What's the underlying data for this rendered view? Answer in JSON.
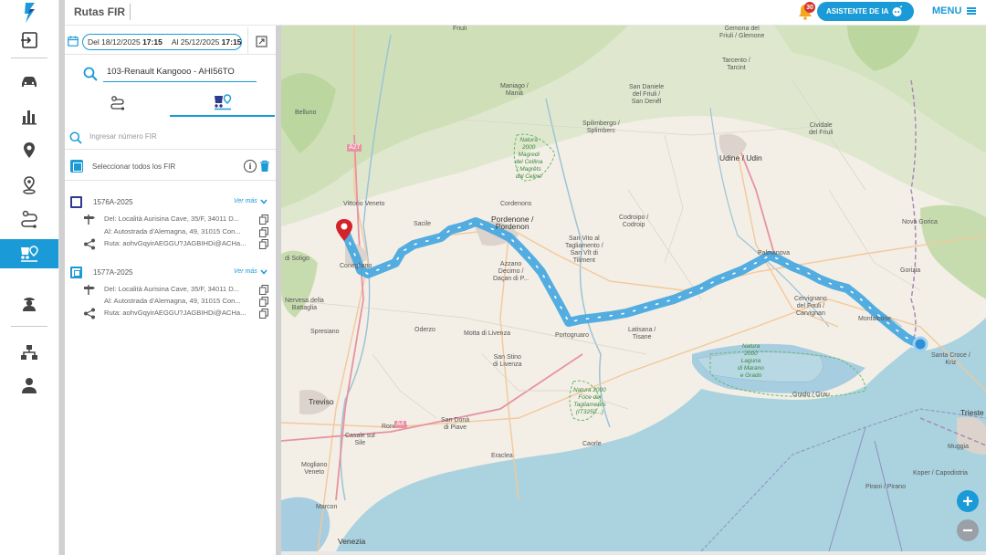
{
  "header": {
    "title": "Rutas FIR",
    "notification_count": "30",
    "ai_button_label": "ASISTENTE DE IA",
    "menu_label": "MENU"
  },
  "colors": {
    "accent": "#1a9ad6",
    "route": "#4aa9df",
    "start_marker": "#d2232a",
    "end_marker": "#2f8fd8"
  },
  "sidebar": {
    "items": [
      {
        "name": "logout-icon"
      },
      {
        "name": "car-icon"
      },
      {
        "name": "bar-chart-icon"
      },
      {
        "name": "location-pin-icon"
      },
      {
        "name": "pin-stand-icon"
      },
      {
        "name": "route-icon"
      },
      {
        "name": "fir-route-icon",
        "active": true
      },
      {
        "name": "driver-icon"
      },
      {
        "name": "hierarchy-icon"
      },
      {
        "name": "user-icon"
      }
    ]
  },
  "filters": {
    "date_from_label": "Del",
    "date_from": "18/12/2025",
    "time_from": "17:15",
    "date_to_label": "Al",
    "date_to": "25/12/2025",
    "time_to": "17:15"
  },
  "vehicle": {
    "value": "103-Renault Kangooo - AHI56TO"
  },
  "fir_panel": {
    "search_placeholder": "Ingresar número FIR",
    "select_all_label": "Seleccionar todos los FIR",
    "see_more": "Ver más",
    "items": [
      {
        "id": "1576A-2025",
        "from": "Del: Località Aurisina Cave, 35/F, 34011 D...",
        "to": "Al: Autostrada d'Alemagna, 49, 31015 Con...",
        "route": "Ruta: aohvGqyirAEGGU?JAGBIHDi@ACHa..."
      },
      {
        "id": "1577A-2025",
        "from": "Del: Località Aurisina Cave, 35/F, 34011 D...",
        "to": "Al: Autostrada d'Alemagna, 49, 31015 Con...",
        "route": "Ruta: aohvGqyirAEGGU?JAGBIHDi@ACHa..."
      }
    ]
  },
  "map": {
    "labels": {
      "friuli": "Friuli",
      "belluno": "Belluno",
      "maniago": "Maniago /\nManià",
      "san_daniele": "San Daniele\ndel Friuli /\nSan Denêl",
      "spilimbergo": "Spilimbergo /\nSplimberc",
      "tarcento": "Tarcento /\nTarcint",
      "gemona": "Gemona del\nFriuli / Glemone",
      "udine": "Udine / Udin",
      "cividale": "Cividale\ndel Friuli",
      "natura_magredi": "Natura\n2000\nMagredi\ndel Cellina\n/ Magrêts\ndal Celine",
      "cordenons": "Cordenons",
      "pordenone": "Pordenone /\nPordenon",
      "sacile": "Sacile",
      "vittorio_veneto": "Vittorio Veneto",
      "conegliano": "Conegliano",
      "soligo": "di Soligo",
      "codroipo": "Codroipo /\nCodroip",
      "san_vito": "San Vito al\nTagliamento /\nSan Vît di\nTiliment",
      "azzano": "Azzano\nDecimo /\nDaçan di P...",
      "nova_gorica": "Nova Gorica",
      "gorizia": "Gorizia",
      "palmanova": "Palmanova",
      "cervignano": "Cervignano\ndel Friuli /\nCarvignan",
      "nervesa": "Nervesa della\nBattaglia",
      "spresiano": "Spresiano",
      "oderzo": "Oderzo",
      "motta": "Motta di Livenza",
      "portogruaro": "Portogruaro",
      "latisana": "Latisana /\nTisane",
      "san_stino": "San Stino\ndi Livenza",
      "natura_laguna": "Natura\n2000\nLaguna\ndi Marano\ne Grado",
      "grado": "Grado / Grau",
      "treviso": "Treviso",
      "san_dona": "San Donà\ndi Piave",
      "roncade": "Roncade",
      "caorle": "Caorle",
      "eraclea": "Eraclea",
      "natura_foce": "Natura 2000\nFoce del\nTagliamento\n(IT3250...)",
      "monfalcone": "Monfalcone",
      "santa_croce": "Santa Croce /\nKriz",
      "trieste": "Trieste",
      "muggia": "Muggia",
      "koper": "Koper / Capodistria",
      "piran": "Pirani / Pirano",
      "venezia": "Venezia",
      "mogliano": "Mogliano\nVeneto",
      "casale": "Casale sul\nSile",
      "a27": "A27",
      "a4": "A4",
      "marcon": "Marcon"
    }
  }
}
